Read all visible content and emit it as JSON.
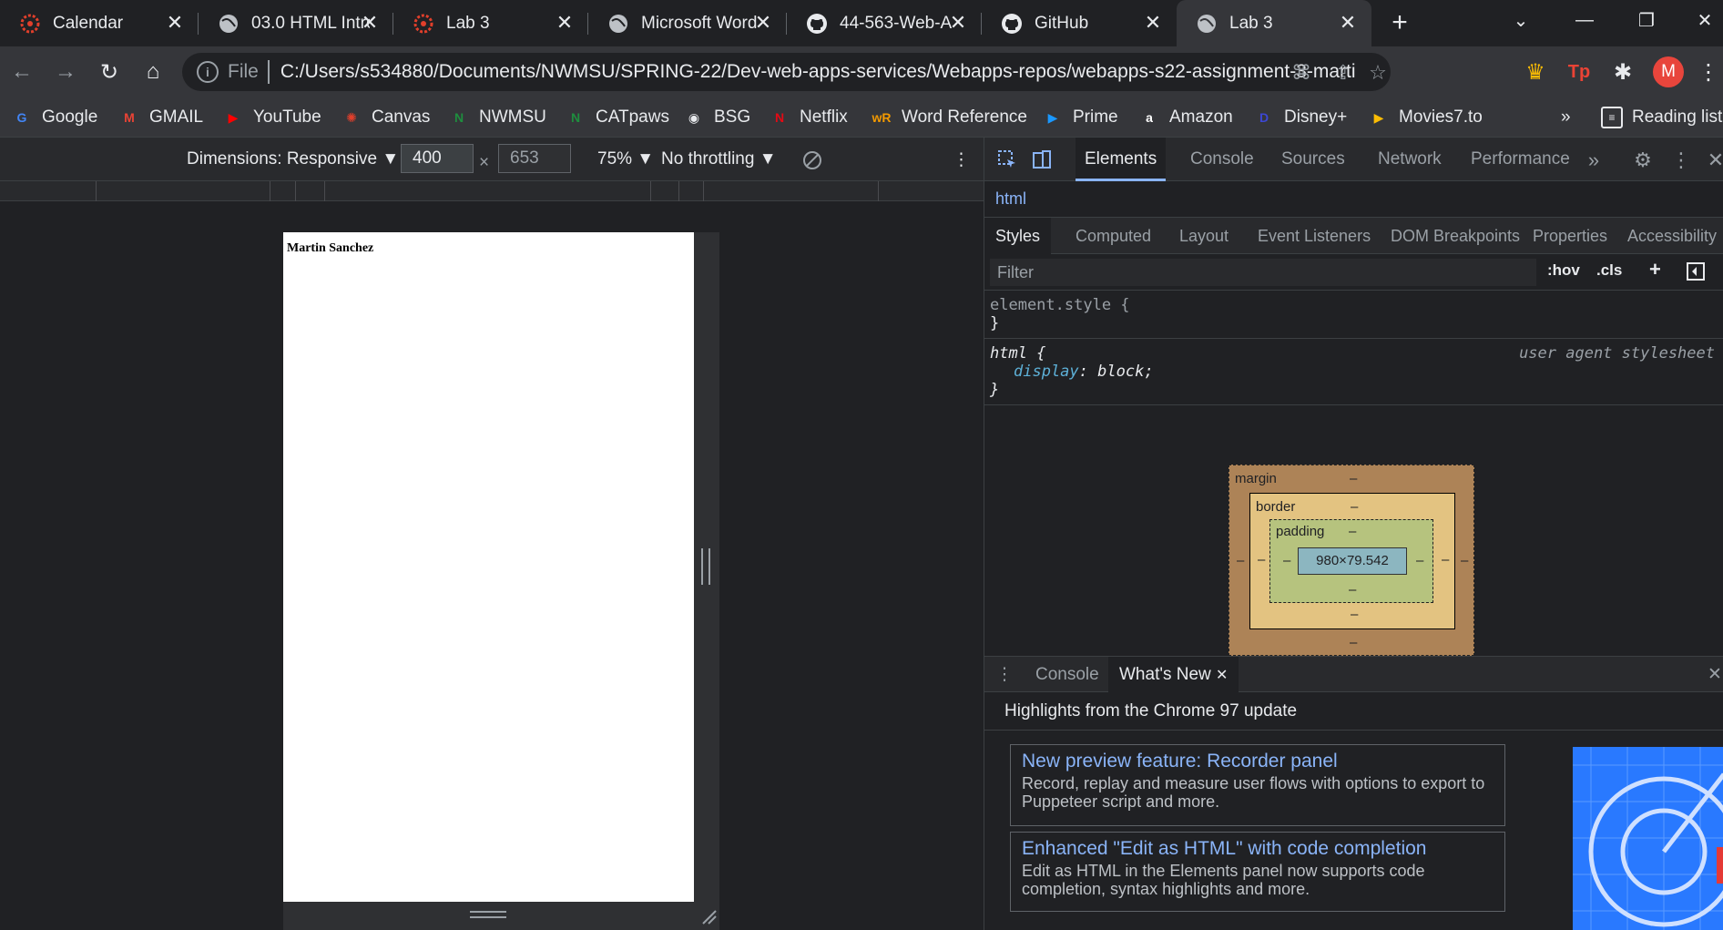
{
  "tabs": [
    {
      "label": "Calendar",
      "icon": "canvas-icon"
    },
    {
      "label": "03.0 HTML Intro",
      "icon": "globe-icon"
    },
    {
      "label": "Lab 3",
      "icon": "canvas-icon"
    },
    {
      "label": "Microsoft Word",
      "icon": "globe-icon"
    },
    {
      "label": "44-563-Web-A",
      "icon": "github-icon"
    },
    {
      "label": "GitHub",
      "icon": "github-icon"
    },
    {
      "label": "Lab 3",
      "icon": "globe-icon",
      "active": true
    }
  ],
  "window_controls": {
    "chevron": "⌄",
    "minimize": "—",
    "restore": "❐",
    "close": "✕"
  },
  "toolbar": {
    "scheme": "File",
    "url": "C:/Users/s534880/Documents/NWMSU/SPRING-22/Dev-web-apps-services/Webapps-repos/webapps-s22-assignment-3-marti...",
    "avatar_letter": "M",
    "info_glyph": "i",
    "translate_glyph": "⌘",
    "share_glyph": "⇪",
    "star_glyph": "☆",
    "crown_glyph": "♛",
    "tp_glyph": "Tp",
    "puzzle_glyph": "✱",
    "menu_glyph": "⋮",
    "back_glyph": "←",
    "forward_glyph": "→",
    "reload_glyph": "↻",
    "home_glyph": "⌂"
  },
  "bookmarks": [
    {
      "label": "Google",
      "glyph": "G",
      "color": "#4285f4"
    },
    {
      "label": "GMAIL",
      "glyph": "M",
      "color": "#ea4335"
    },
    {
      "label": "YouTube",
      "glyph": "▶",
      "color": "#ff0000"
    },
    {
      "label": "Canvas",
      "glyph": "✺",
      "color": "#e13f2b"
    },
    {
      "label": "NWMSU",
      "glyph": "N",
      "color": "#1e8e3e"
    },
    {
      "label": "CATpaws",
      "glyph": "N",
      "color": "#1e8e3e"
    },
    {
      "label": "BSG",
      "glyph": "◉",
      "color": "#e8eaed"
    },
    {
      "label": "Netflix",
      "glyph": "N",
      "color": "#e50914"
    },
    {
      "label": "Word Reference",
      "glyph": "wR",
      "color": "#f29900"
    },
    {
      "label": "Prime",
      "glyph": "▶",
      "color": "#1a98ff"
    },
    {
      "label": "Amazon",
      "glyph": "a",
      "color": "#ffffff"
    },
    {
      "label": "Disney+",
      "glyph": "D",
      "color": "#3c47d3"
    },
    {
      "label": "Movies7.to",
      "glyph": "▶",
      "color": "#fbbc04"
    }
  ],
  "bookmarks_overflow": "»",
  "reading_list": "Reading list",
  "device_toolbar": {
    "dimensions": "Dimensions: Responsive ▼",
    "width": "400",
    "times": "×",
    "height": "653",
    "zoom": "75% ▼",
    "throttling": "No throttling ▼",
    "more": "⋮"
  },
  "page": {
    "name": "Martin Sanchez"
  },
  "devtools": {
    "tabs": [
      "Elements",
      "Console",
      "Sources",
      "Network",
      "Performance"
    ],
    "more_tabs": "»",
    "breadcrumb": "html",
    "sub_tabs": [
      "Styles",
      "Computed",
      "Layout",
      "Event Listeners",
      "DOM Breakpoints",
      "Properties",
      "Accessibility"
    ],
    "filter_placeholder": "Filter",
    "hov": ":hov",
    "cls": ".cls",
    "plus": "+",
    "rules": {
      "element_style": "element.style {",
      "close": "}",
      "html_selector": "html {",
      "origin": "user agent stylesheet",
      "prop": "display",
      "val": "block;"
    },
    "box_model": {
      "margin": "margin",
      "border": "border",
      "padding": "padding",
      "content": "980×79.542",
      "dash": "–"
    },
    "drawer_tabs": [
      "Console",
      "What's New"
    ],
    "drawer_close": "✕",
    "highlights": "Highlights from the Chrome 97 update",
    "cards": [
      {
        "title": "New preview feature: Recorder panel",
        "desc": "Record, replay and measure user flows with options to export to Puppeteer script and more."
      },
      {
        "title": "Enhanced \"Edit as HTML\" with code completion",
        "desc": "Edit as HTML in the Elements panel now supports code completion, syntax highlights and more."
      }
    ]
  }
}
